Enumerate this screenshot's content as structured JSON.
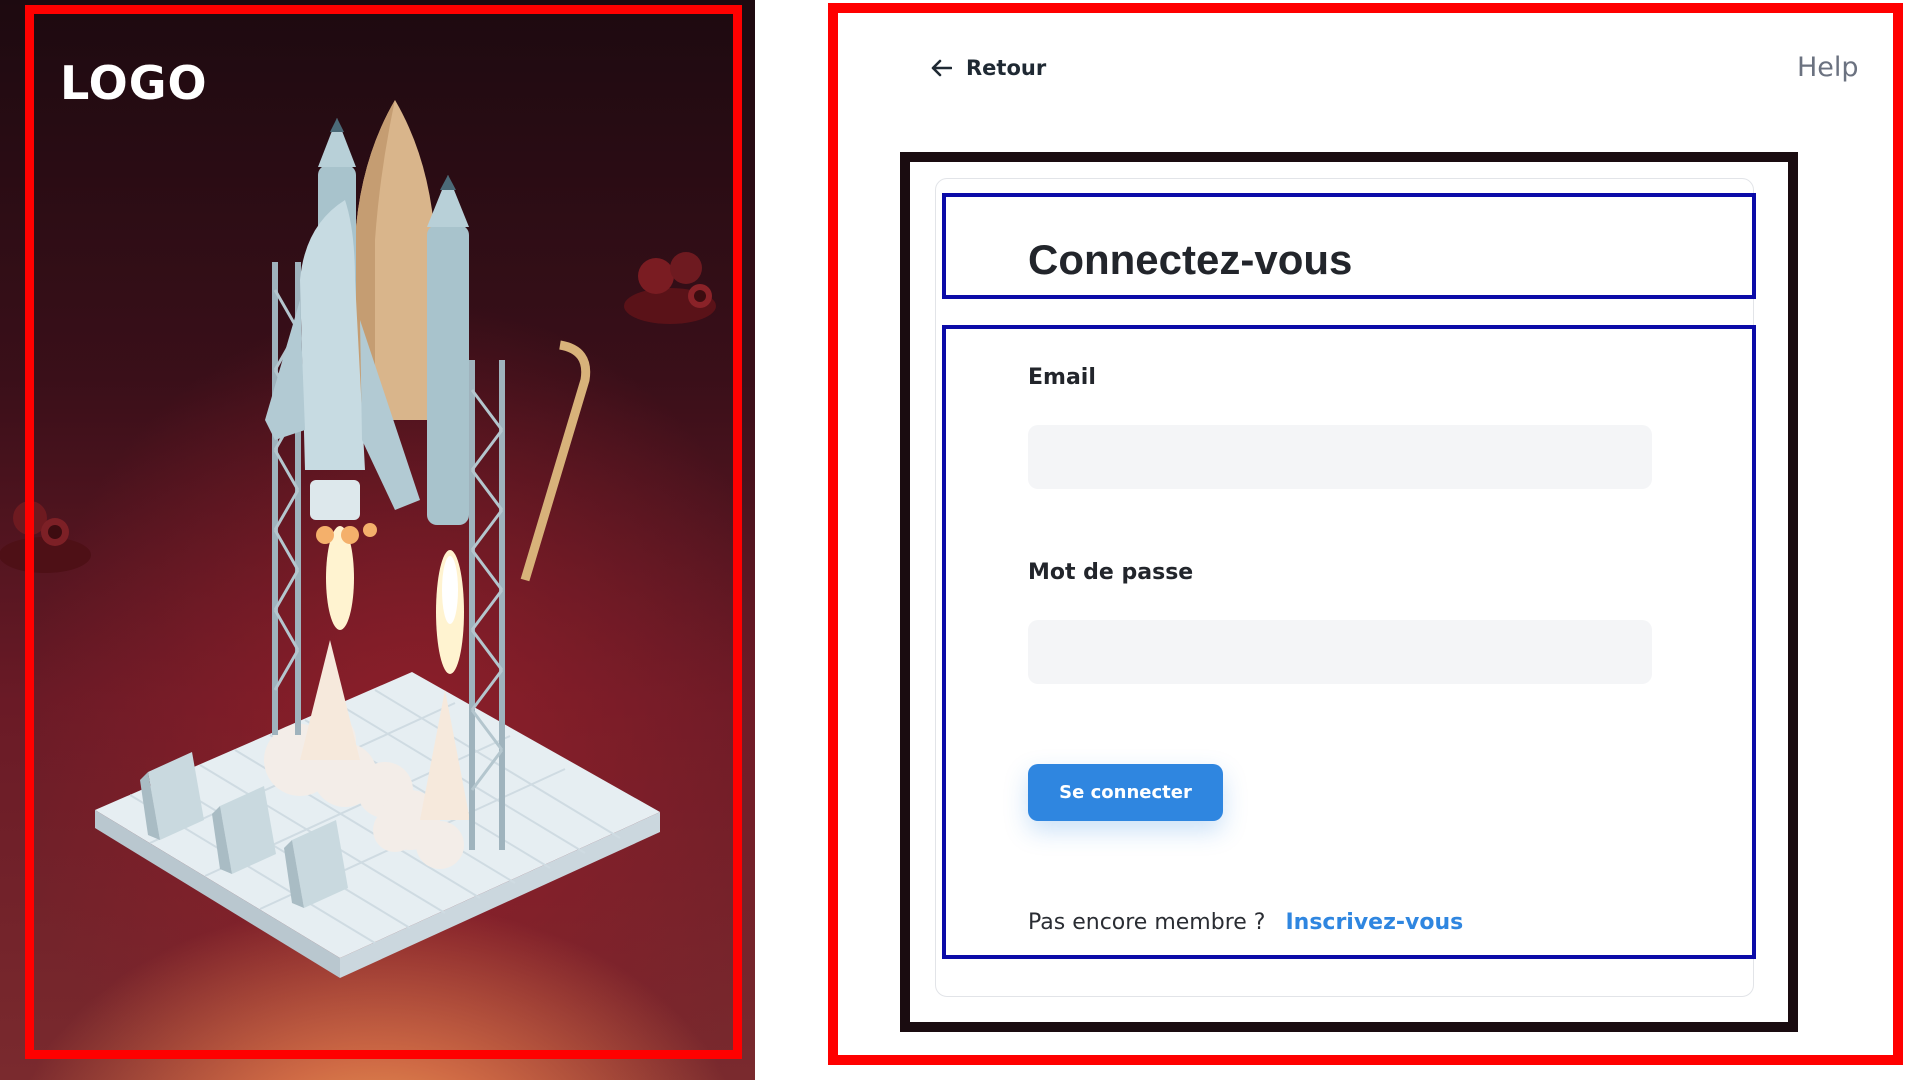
{
  "hero": {
    "logo_text": "LOGO",
    "illustration": "rocket-launch-illustration"
  },
  "nav": {
    "back_label": "Retour",
    "back_icon": "arrow-left-icon",
    "help_label": "Help"
  },
  "login": {
    "title": "Connectez-vous",
    "email_label": "Email",
    "email_value": "",
    "password_label": "Mot de passe",
    "password_value": "",
    "submit_label": "Se connecter",
    "signup_prompt": "Pas encore membre ?",
    "signup_link": "Inscrivez-vous"
  },
  "colors": {
    "accent": "#2f86e0",
    "input_bg": "#f4f5f7",
    "highlight_red": "#ff0000",
    "highlight_blue": "#0b0ba8",
    "hero_bg_dark": "#2a0c14"
  }
}
